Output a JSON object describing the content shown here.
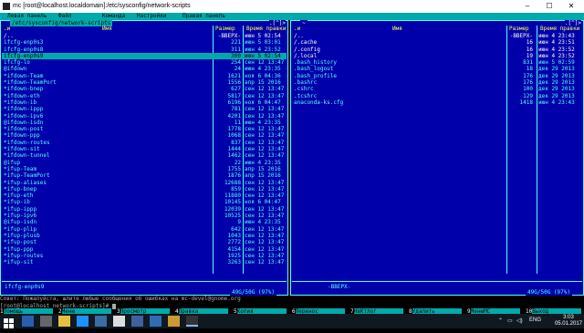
{
  "window": {
    "title": "mc [root@localhost.localdomain]:/etc/sysconfig/network-scripts",
    "minimize": "–",
    "maximize": "☐",
    "close": "✕"
  },
  "menu": [
    "Левая панель",
    "Файл",
    "Команда",
    "Настройки",
    "Правая панель"
  ],
  "left_panel": {
    "path": "/etc/sysconfig/network-scripts",
    "corner": ".[^]>",
    "headers": {
      "sort": ".и",
      "name": "Имя",
      "size": "Размер",
      "time": "Время правки"
    },
    "rows": [
      {
        "name": "/..",
        "size": "-ВВЕРХ-",
        "date": "июн  5 02:54",
        "kind": "dir"
      },
      {
        "name": " ifcfg-enp0s3",
        "size": "221",
        "date": "июн  5 03:01",
        "kind": ""
      },
      {
        "name": " ifcfg-enp0s8",
        "size": "311",
        "date": "июн  4 23:52",
        "kind": ""
      },
      {
        "name": " ifcfg-enp0s9",
        "size": "300",
        "date": "июн  5 02:54",
        "kind": "sel"
      },
      {
        "name": " ifcfg-lo",
        "size": "254",
        "date": "сен 12 13:47",
        "kind": ""
      },
      {
        "name": "@ifdown",
        "size": "24",
        "date": "июн  4 23:35",
        "kind": ""
      },
      {
        "name": "*ifdown-Team",
        "size": "1621",
        "date": "ноя  6 04:36",
        "kind": ""
      },
      {
        "name": "*ifdown-TeamPort",
        "size": "1556",
        "date": "апр 15  2016",
        "kind": ""
      },
      {
        "name": "*ifdown-bnep",
        "size": "627",
        "date": "сен 12 13:47",
        "kind": ""
      },
      {
        "name": "*ifdown-eth",
        "size": "5817",
        "date": "сен 12 13:47",
        "kind": ""
      },
      {
        "name": "*ifdown-ib",
        "size": "6196",
        "date": "ноя  6 04:47",
        "kind": ""
      },
      {
        "name": "*ifdown-ippp",
        "size": "781",
        "date": "сен 12 13:47",
        "kind": ""
      },
      {
        "name": "*ifdown-ipv6",
        "size": "4201",
        "date": "сен 12 13:47",
        "kind": ""
      },
      {
        "name": "@ifdown-isdn",
        "size": "11",
        "date": "июн  4 23:35",
        "kind": ""
      },
      {
        "name": "*ifdown-post",
        "size": "1778",
        "date": "сен 12 13:47",
        "kind": ""
      },
      {
        "name": "*ifdown-ppp",
        "size": "1068",
        "date": "сен 12 13:47",
        "kind": ""
      },
      {
        "name": "*ifdown-routes",
        "size": "837",
        "date": "сен 12 13:47",
        "kind": ""
      },
      {
        "name": "*ifdown-sit",
        "size": "1444",
        "date": "сен 12 13:47",
        "kind": ""
      },
      {
        "name": "*ifdown-tunnel",
        "size": "1462",
        "date": "сен 12 13:47",
        "kind": ""
      },
      {
        "name": "@ifup",
        "size": "22",
        "date": "июн  4 23:35",
        "kind": ""
      },
      {
        "name": "*ifup-Team",
        "size": "1755",
        "date": "апр 15  2016",
        "kind": ""
      },
      {
        "name": "*ifup-TeamPort",
        "size": "1876",
        "date": "апр 15  2016",
        "kind": ""
      },
      {
        "name": "*ifup-aliases",
        "size": "12688",
        "date": "сен 12 13:47",
        "kind": ""
      },
      {
        "name": "*ifup-bnep",
        "size": "859",
        "date": "сен 12 13:47",
        "kind": ""
      },
      {
        "name": "*ifup-eth",
        "size": "11880",
        "date": "сен 12 13:47",
        "kind": ""
      },
      {
        "name": "*ifup-ib",
        "size": "10145",
        "date": "ноя  6 04:47",
        "kind": ""
      },
      {
        "name": "*ifup-ippp",
        "size": "12039",
        "date": "сен 12 13:47",
        "kind": ""
      },
      {
        "name": "*ifup-ipv6",
        "size": "10525",
        "date": "сен 12 13:47",
        "kind": ""
      },
      {
        "name": "@ifup-isdn",
        "size": "9",
        "date": "июн  4 23:35",
        "kind": ""
      },
      {
        "name": "*ifup-plip",
        "size": "642",
        "date": "сен 12 13:47",
        "kind": ""
      },
      {
        "name": "*ifup-plusb",
        "size": "1043",
        "date": "сен 12 13:47",
        "kind": ""
      },
      {
        "name": "*ifup-post",
        "size": "2772",
        "date": "сен 12 13:47",
        "kind": ""
      },
      {
        "name": "*ifup-ppp",
        "size": "4154",
        "date": "сен 12 13:47",
        "kind": ""
      },
      {
        "name": "*ifup-routes",
        "size": "1925",
        "date": "сен 12 13:47",
        "kind": ""
      },
      {
        "name": "*ifup-sit",
        "size": "3263",
        "date": "сен 12 13:47",
        "kind": ""
      }
    ],
    "mini_status": "ifcfg-enp0s9",
    "free_space": "49G/50G (97%)"
  },
  "right_panel": {
    "path": "~",
    "corner": ".[^]>",
    "headers": {
      "sort": ".и",
      "name": "Имя",
      "size": "Размер",
      "time": "Время правки"
    },
    "rows": [
      {
        "name": "/..",
        "size": "-ВВЕРХ-",
        "date": "июн  4 23:43",
        "kind": "dir"
      },
      {
        "name": "/.cache",
        "size": "16",
        "date": "июн  4 23:51",
        "kind": "dir"
      },
      {
        "name": "/.config",
        "size": "16",
        "date": "июн  4 23:52",
        "kind": "dir"
      },
      {
        "name": "/.local",
        "size": "19",
        "date": "июн  4 23:52",
        "kind": "dir"
      },
      {
        "name": " .bash_history",
        "size": "831",
        "date": "июн  5 02:59",
        "kind": ""
      },
      {
        "name": " .bash_logout",
        "size": "18",
        "date": "дек 29  2013",
        "kind": ""
      },
      {
        "name": " .bash_profile",
        "size": "176",
        "date": "дек 29  2013",
        "kind": ""
      },
      {
        "name": " .bashrc",
        "size": "176",
        "date": "дек 29  2013",
        "kind": ""
      },
      {
        "name": " .cshrc",
        "size": "100",
        "date": "дек 29  2013",
        "kind": ""
      },
      {
        "name": " .tcshrc",
        "size": "129",
        "date": "дек 29  2013",
        "kind": ""
      },
      {
        "name": " anaconda-ks.cfg",
        "size": "1418",
        "date": "июн  4 23:43",
        "kind": ""
      }
    ],
    "mini_status": "-ВВЕРХ-",
    "free_space": "49G/50G (97%)"
  },
  "hint": "Совет: Пожалуйста, шлите любые сообщения об ошибках на mc-devel@gnome.org",
  "prompt": "[root@localhost network-scripts]#",
  "fkeys": [
    {
      "num": "1",
      "label": "Помощь"
    },
    {
      "num": "2",
      "label": "Меню"
    },
    {
      "num": "3",
      "label": "Просмотр"
    },
    {
      "num": "4",
      "label": "Правка"
    },
    {
      "num": "5",
      "label": "Копия"
    },
    {
      "num": "6",
      "label": "Перенос"
    },
    {
      "num": "7",
      "label": "НвКтлог"
    },
    {
      "num": "8",
      "label": "Удалить"
    },
    {
      "num": "9",
      "label": "МенюМС"
    },
    {
      "num": "10",
      "label": "Выход"
    }
  ],
  "taskbar": {
    "lang": "ENG",
    "time": "3:03",
    "date": "05.01.2017"
  }
}
